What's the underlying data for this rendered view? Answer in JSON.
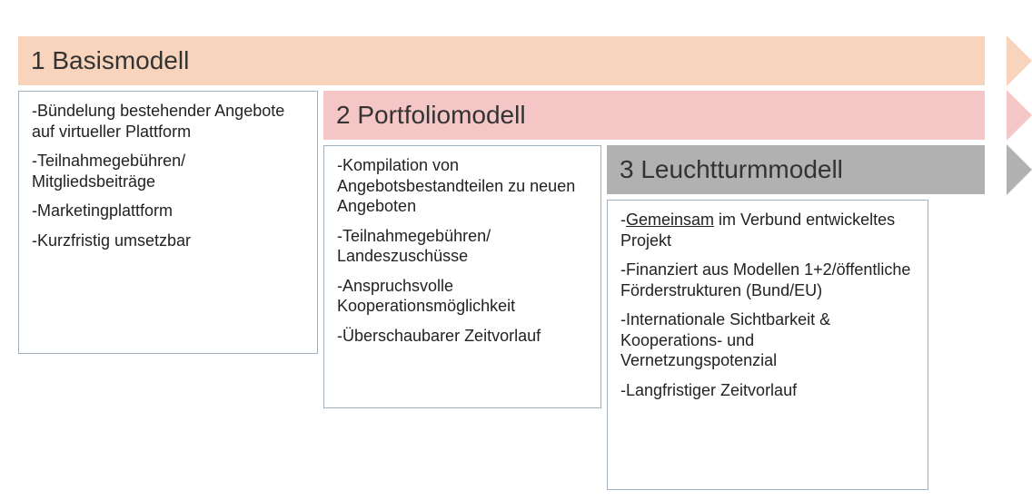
{
  "bands": [
    {
      "title": "1 Basismodell"
    },
    {
      "title": "2 Portfoliomodell"
    },
    {
      "title": "3 Leuchtturmmodell"
    }
  ],
  "box1": {
    "items": [
      "-Bündelung bestehender Angebote auf virtueller Plattform",
      "-Teilnahmegebühren/ Mitgliedsbeiträge",
      "-Marketingplattform",
      "-Kurzfristig umsetzbar"
    ]
  },
  "box2": {
    "items": [
      "-Kompilation von Angebotsbestandteilen zu neuen Angeboten",
      "-Teilnahmegebühren/ Landeszuschüsse",
      "-Anspruchsvolle Kooperationsmöglichkeit",
      "-Überschaubarer Zeitvorlauf"
    ]
  },
  "box3": {
    "item0_prefix": "-",
    "item0_underlined": "Gemeinsam",
    "item0_suffix": " im Verbund entwickeltes Projekt",
    "items_rest": [
      "-Finanziert aus Modellen 1+2/öffentliche Förderstrukturen (Bund/EU)",
      "-Internationale Sichtbarkeit & Kooperations- und Vernetzungspotenzial",
      "-Langfristiger Zeitvorlauf"
    ]
  }
}
